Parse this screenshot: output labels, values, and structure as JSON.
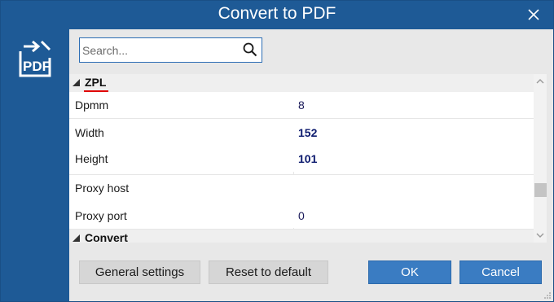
{
  "window": {
    "title": "Convert to PDF",
    "icons": {
      "close": "close-icon",
      "logo": "pdf-export-icon"
    }
  },
  "search": {
    "placeholder": "Search...",
    "value": "",
    "icon": "search-icon"
  },
  "grid": {
    "categories": [
      {
        "label": "ZPL",
        "expanded": true
      },
      {
        "label": "Convert",
        "expanded": true
      }
    ],
    "rows": [
      {
        "name": "Dpmm",
        "value": "8",
        "bold": false
      },
      {
        "name": "Width",
        "value": "152",
        "bold": true
      },
      {
        "name": "Height",
        "value": "101",
        "bold": true
      },
      {
        "name": "Proxy host",
        "value": "",
        "bold": false
      },
      {
        "name": "Proxy port",
        "value": "0",
        "bold": false
      }
    ]
  },
  "buttons": {
    "general_settings": "General settings",
    "reset_default": "Reset to default",
    "ok": "OK",
    "cancel": "Cancel"
  },
  "colors": {
    "titlebar": "#1e5a96",
    "accent_underline": "#e00000",
    "primary_button": "#3a7cc2"
  }
}
